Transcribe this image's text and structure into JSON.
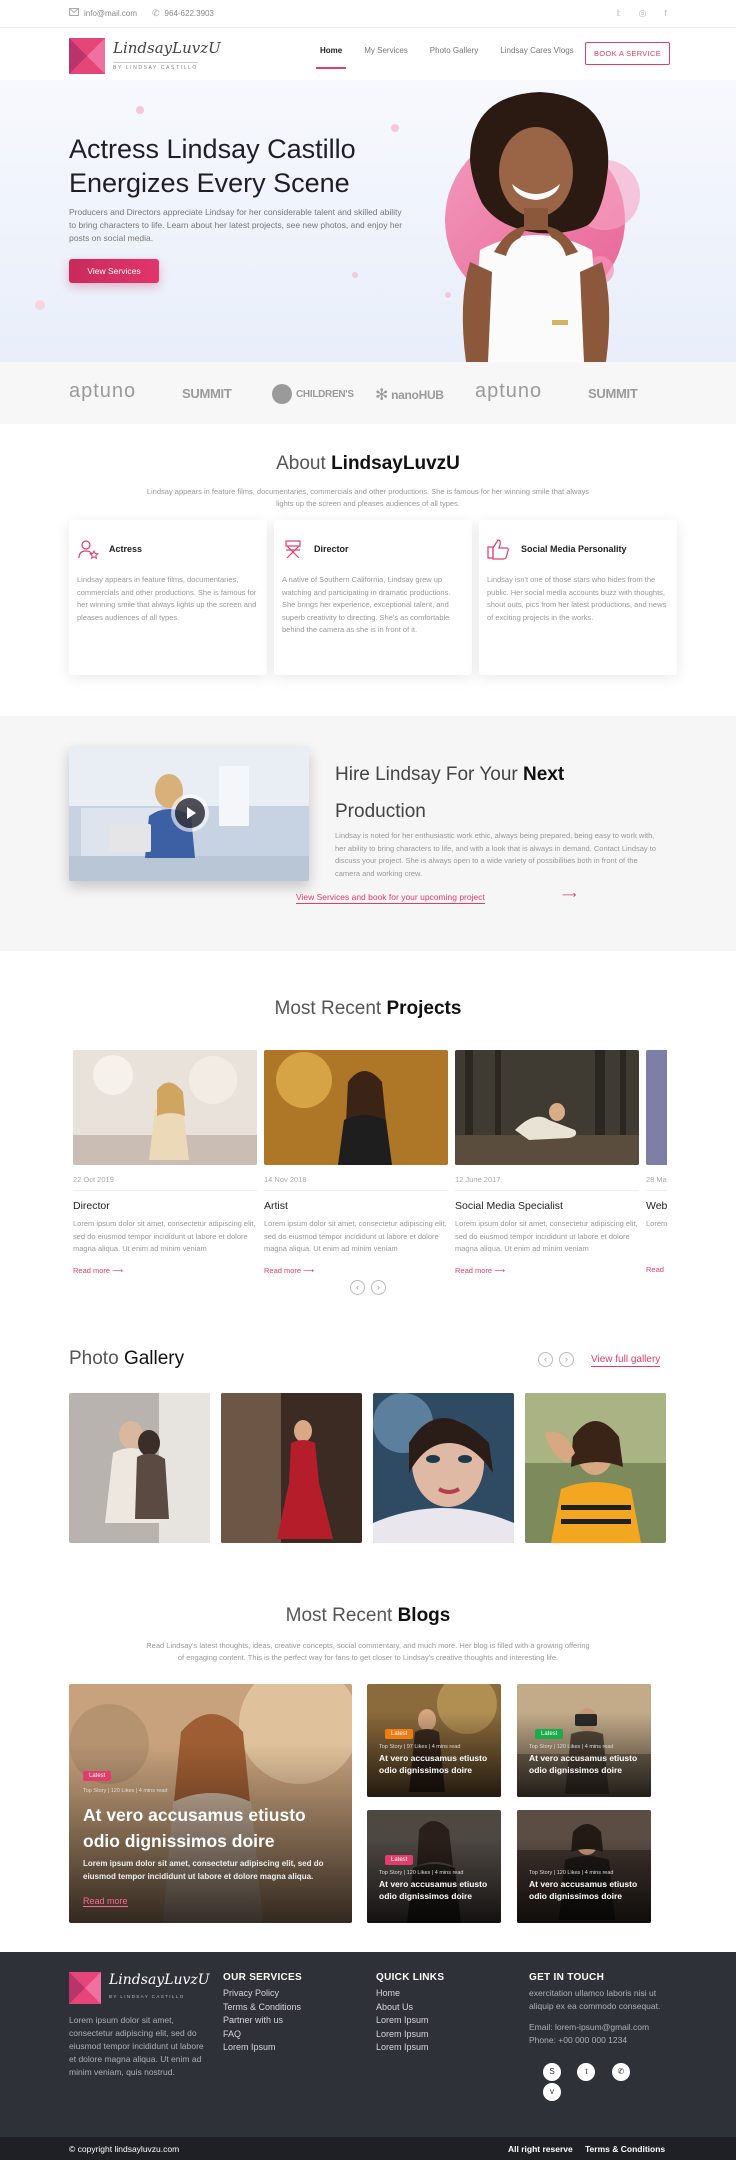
{
  "topbar": {
    "email": "info@mail.com",
    "phone": "964-622.3903",
    "social": [
      "twitter-icon",
      "instagram-icon",
      "facebook-icon"
    ]
  },
  "header": {
    "logo_script": "LindsayLuvzU",
    "logo_tagline": "BY LINDSAY CASTILLO",
    "nav": [
      "Home",
      "My Services",
      "Photo Gallery",
      "Lindsay Cares Vlogs"
    ],
    "active_nav": "Home",
    "cta": "BOOK A SERVICE"
  },
  "hero": {
    "title": "Actress Lindsay Castillo Energizes Every Scene",
    "text": "Producers and Directors appreciate Lindsay for her considerable talent and skilled ability to bring characters to life. Learn about her latest projects, see new photos, and enjoy her posts on social media.",
    "button": "View Services"
  },
  "partners": [
    "aptuno",
    "SUMMIT",
    "CHILDREN'S",
    "nanoHUB",
    "aptuno",
    "SUMMIT"
  ],
  "about": {
    "title_light": "About ",
    "title_bold": "LindsayLuvzU",
    "subtitle": "Lindsay appears in feature films, documentaries, commercials and other productions. She is famous for her winning smile that always lights up the screen and pleases audiences of all types.",
    "cards": [
      {
        "icon": "actress-icon",
        "title": "Actress",
        "text": "Lindsay appears in feature films, documentaries, commercials and other productions. She is famous for her winning smile that always lights up the screen and pleases audiences of all types."
      },
      {
        "icon": "director-chair-icon",
        "title": "Director",
        "text": "A native of Southern California, Lindsay grew up watching and participating in dramatic productions. She brings her experience, exceptional talent, and superb creativity to directing. She's as comfortable behind the camera as she is in front of it."
      },
      {
        "icon": "thumbs-up-icon",
        "title": "Social Media Personality",
        "text": "Lindsay isn't one of those stars who hides from the public. Her social media accounts buzz with thoughts, shout outs, pics from her latest productions, and news of exciting projects in the works."
      }
    ]
  },
  "hire": {
    "title_light": "Hire Lindsay For Your ",
    "title_bold": "Next",
    "title_line2": "Production",
    "text": "Lindsay is noted for her enthusiastic work ethic, always being prepared, being easy to work with, her ability to bring characters to life, and with a look that is always in demand. Contact Lindsay to discuss your project. She is always open to a wide variety of possibilities both in front of the camera and working crew.",
    "link": "View Services and book for your upcoming project"
  },
  "projects": {
    "title_light": "Most Recent ",
    "title_bold": "Projects",
    "items": [
      {
        "date": "22 Oct 2019",
        "title": "Director",
        "text": "Lorem ipsum dolor sit amet, consectetur adipiscing elit, sed do eiusmod tempor incididunt ut labore et dolore magna aliqua. Ut enim ad minim veniam",
        "link": "Read more"
      },
      {
        "date": "14 Nov 2018",
        "title": "Artist",
        "text": "Lorem ipsum dolor sit amet, consectetur adipiscing elit, sed do eiusmod tempor incididunt ut labore et dolore magna aliqua. Ut enim ad minim veniam",
        "link": "Read more"
      },
      {
        "date": "12 June 2017",
        "title": "Social Media Specialist",
        "text": "Lorem ipsum dolor sit amet, consectetur adipiscing elit, sed do eiusmod tempor incididunt ut labore et dolore magna aliqua. Ut enim ad minim veniam",
        "link": "Read more"
      },
      {
        "date": "28 Ma",
        "title": "Web",
        "text": "Lorem",
        "link": "Read"
      }
    ]
  },
  "gallery": {
    "title_light": "Photo ",
    "title_bold": "Gallery",
    "link": "View full gallery"
  },
  "blogs": {
    "title_light": "Most Recent ",
    "title_bold": "Blogs",
    "subtitle": "Read Lindsay's latest thoughts, ideas, creative concepts, social commentary, and much more. Her blog is filled with a growing offering of engaging content. This is the perfect way for fans to get closer to Lindsay's creative thoughts and interesting life.",
    "featured": {
      "badge": "Latest",
      "meta": "Top Story | 120 Likes | 4 mins read",
      "title": "At vero accusamus etiusto odio dignissimos doire",
      "text": "Lorem ipsum dolor sit amet, consectetur adipiscing elit, sed do eiusmod tempor incididunt ut labore et dolore magna aliqua.",
      "link": "Read more"
    },
    "small": [
      {
        "badge": "Latest",
        "badge_color": "#ef7b11",
        "meta": "Top Story | 97 Likes | 4 mins read",
        "title": "At vero accusamus etiusto odio dignissimos doire"
      },
      {
        "badge": "Latest",
        "badge_color": "#1aab4b",
        "meta": "Top Story | 120 Likes | 4 mins read",
        "title": "At vero accusamus etiusto odio dignissimos doire"
      },
      {
        "badge": "Latest",
        "badge_color": "#e03d6b",
        "meta": "Top Story | 120 Likes | 4 mins read",
        "title": "At vero accusamus etiusto odio dignissimos doire"
      },
      {
        "badge": "",
        "badge_color": "",
        "meta": "Top Story | 120 Likes | 4 mins read",
        "title": "At vero accusamus etiusto odio dignissimos doire"
      }
    ]
  },
  "footer": {
    "about_text": "Lorem ipsum dolor sit amet, consectetur adipiscing elit, sed do eiusmod tempor incididunt ut labore et dolore magna aliqua. Ut enim ad minim veniam, quis nostrud.",
    "services_head": "OUR SERVICES",
    "services": [
      "Privacy Policy",
      "Terms & Conditions",
      "Partner with us",
      "FAQ",
      "Lorem Ipsum"
    ],
    "links_head": "QUICK LINKS",
    "links": [
      "Home",
      "About Us",
      "Lorem Ipsum",
      "Lorem Ipsum",
      "Lorem Ipsum"
    ],
    "contact_head": "GET IN TOUCH",
    "contact_text": "exercitation ullamco laboris nisi ut aliquip ex ea commodo consequat.",
    "email": "Email: lorem-ipsum@gmail.com",
    "phone": "Phone: +00 000 000 1234",
    "social": [
      "skype-icon",
      "twitter-icon",
      "whatsapp-icon",
      "vimeo-icon"
    ],
    "copyright": "© copyright lindsayluvzu.com",
    "bottom_links": [
      "All right reserve",
      "Terms & Conditions"
    ]
  }
}
